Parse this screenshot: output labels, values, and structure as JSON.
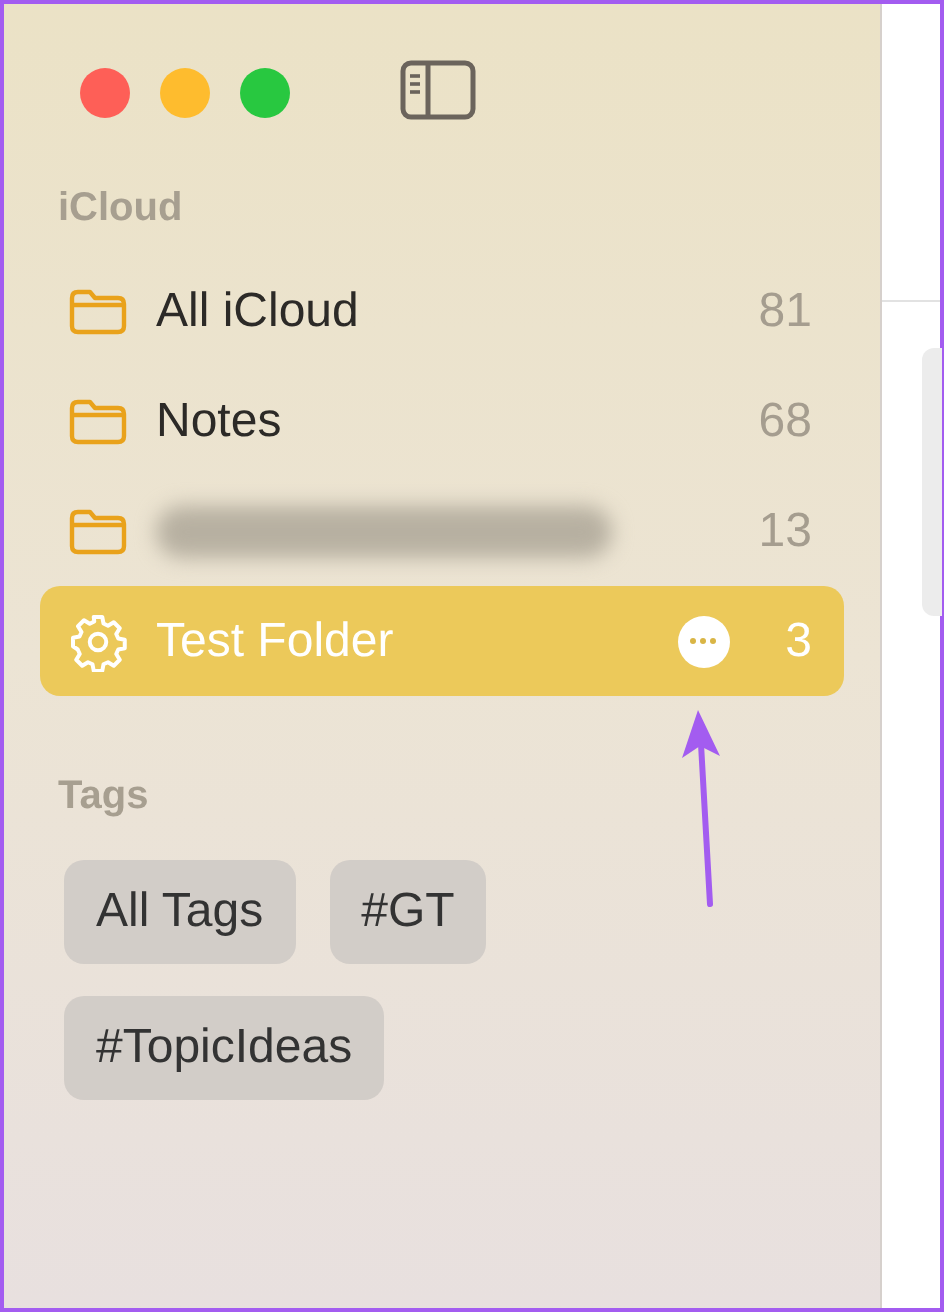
{
  "window": {
    "traffic_lights": [
      {
        "color": "#fe5f57"
      },
      {
        "color": "#febc2e"
      },
      {
        "color": "#28c840"
      }
    ]
  },
  "sidebar": {
    "sections": [
      {
        "title": "iCloud",
        "folders": [
          {
            "kind": "folder",
            "name": "All iCloud",
            "count": "81",
            "redacted": false,
            "selected": false
          },
          {
            "kind": "folder",
            "name": "Notes",
            "count": "68",
            "redacted": false,
            "selected": false
          },
          {
            "kind": "folder",
            "count": "13",
            "redacted": true,
            "selected": false
          },
          {
            "kind": "smart",
            "name": "Test Folder",
            "count": "3",
            "redacted": false,
            "selected": true
          }
        ]
      },
      {
        "title": "Tags",
        "tags": [
          {
            "label": "All Tags"
          },
          {
            "label": "#GT"
          },
          {
            "label": "#TopicIdeas"
          }
        ]
      }
    ]
  },
  "annotation": {
    "kind": "arrow"
  }
}
